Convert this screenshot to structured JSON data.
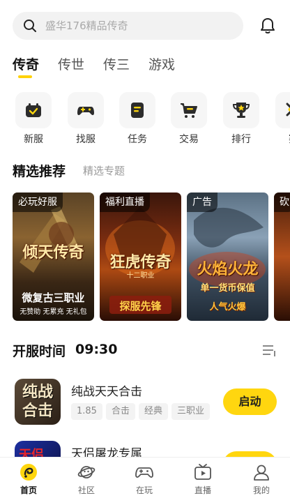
{
  "search": {
    "placeholder": "盛华176精品传奇"
  },
  "tabs": [
    {
      "label": "传奇",
      "active": true
    },
    {
      "label": "传世",
      "active": false
    },
    {
      "label": "传三",
      "active": false
    },
    {
      "label": "游戏",
      "active": false
    }
  ],
  "quick_actions": [
    {
      "label": "新服",
      "icon": "new-server-icon"
    },
    {
      "label": "找服",
      "icon": "gamepad-icon"
    },
    {
      "label": "任务",
      "icon": "task-icon"
    },
    {
      "label": "交易",
      "icon": "cart-icon"
    },
    {
      "label": "排行",
      "icon": "trophy-icon"
    },
    {
      "label": "赛",
      "icon": "partial-icon"
    }
  ],
  "recommend": {
    "title": "精选推荐",
    "subtitle": "精选专题"
  },
  "banners": [
    {
      "tag": "必玩好服",
      "title": "倾天传奇",
      "subtitle": "微复古三职业",
      "caption": "无赞助 无累充 无礼包"
    },
    {
      "tag": "福利直播",
      "title": "狂虎传奇",
      "subtitle": "十二职业",
      "caption": "探服先锋"
    },
    {
      "tag": "广告",
      "title": "火焰火龙",
      "subtitle": "单一货币保值",
      "caption": "人气火爆"
    },
    {
      "tag": "砍",
      "title": "",
      "subtitle": "",
      "caption": ""
    }
  ],
  "server_time": {
    "label": "开服时间",
    "time": "09:30"
  },
  "games": [
    {
      "name": "纯战天天合击",
      "icon_text": "纯战合击",
      "tags": [
        "1.85",
        "合击",
        "经典",
        "三职业"
      ],
      "button": "启动"
    },
    {
      "name": "天侣屠龙专属",
      "icon_text": "天侣",
      "tags": [],
      "button": ""
    }
  ],
  "bottom_nav": [
    {
      "label": "首页",
      "icon": "home-icon",
      "active": true
    },
    {
      "label": "社区",
      "icon": "planet-icon",
      "active": false
    },
    {
      "label": "在玩",
      "icon": "gamepad-icon",
      "active": false
    },
    {
      "label": "直播",
      "icon": "tv-icon",
      "active": false
    },
    {
      "label": "我的",
      "icon": "user-icon",
      "active": false
    }
  ],
  "colors": {
    "accent": "#ffd60f",
    "text": "#1f1f1f",
    "muted": "#9a9a9a",
    "tile_bg": "#f6f6f6"
  }
}
